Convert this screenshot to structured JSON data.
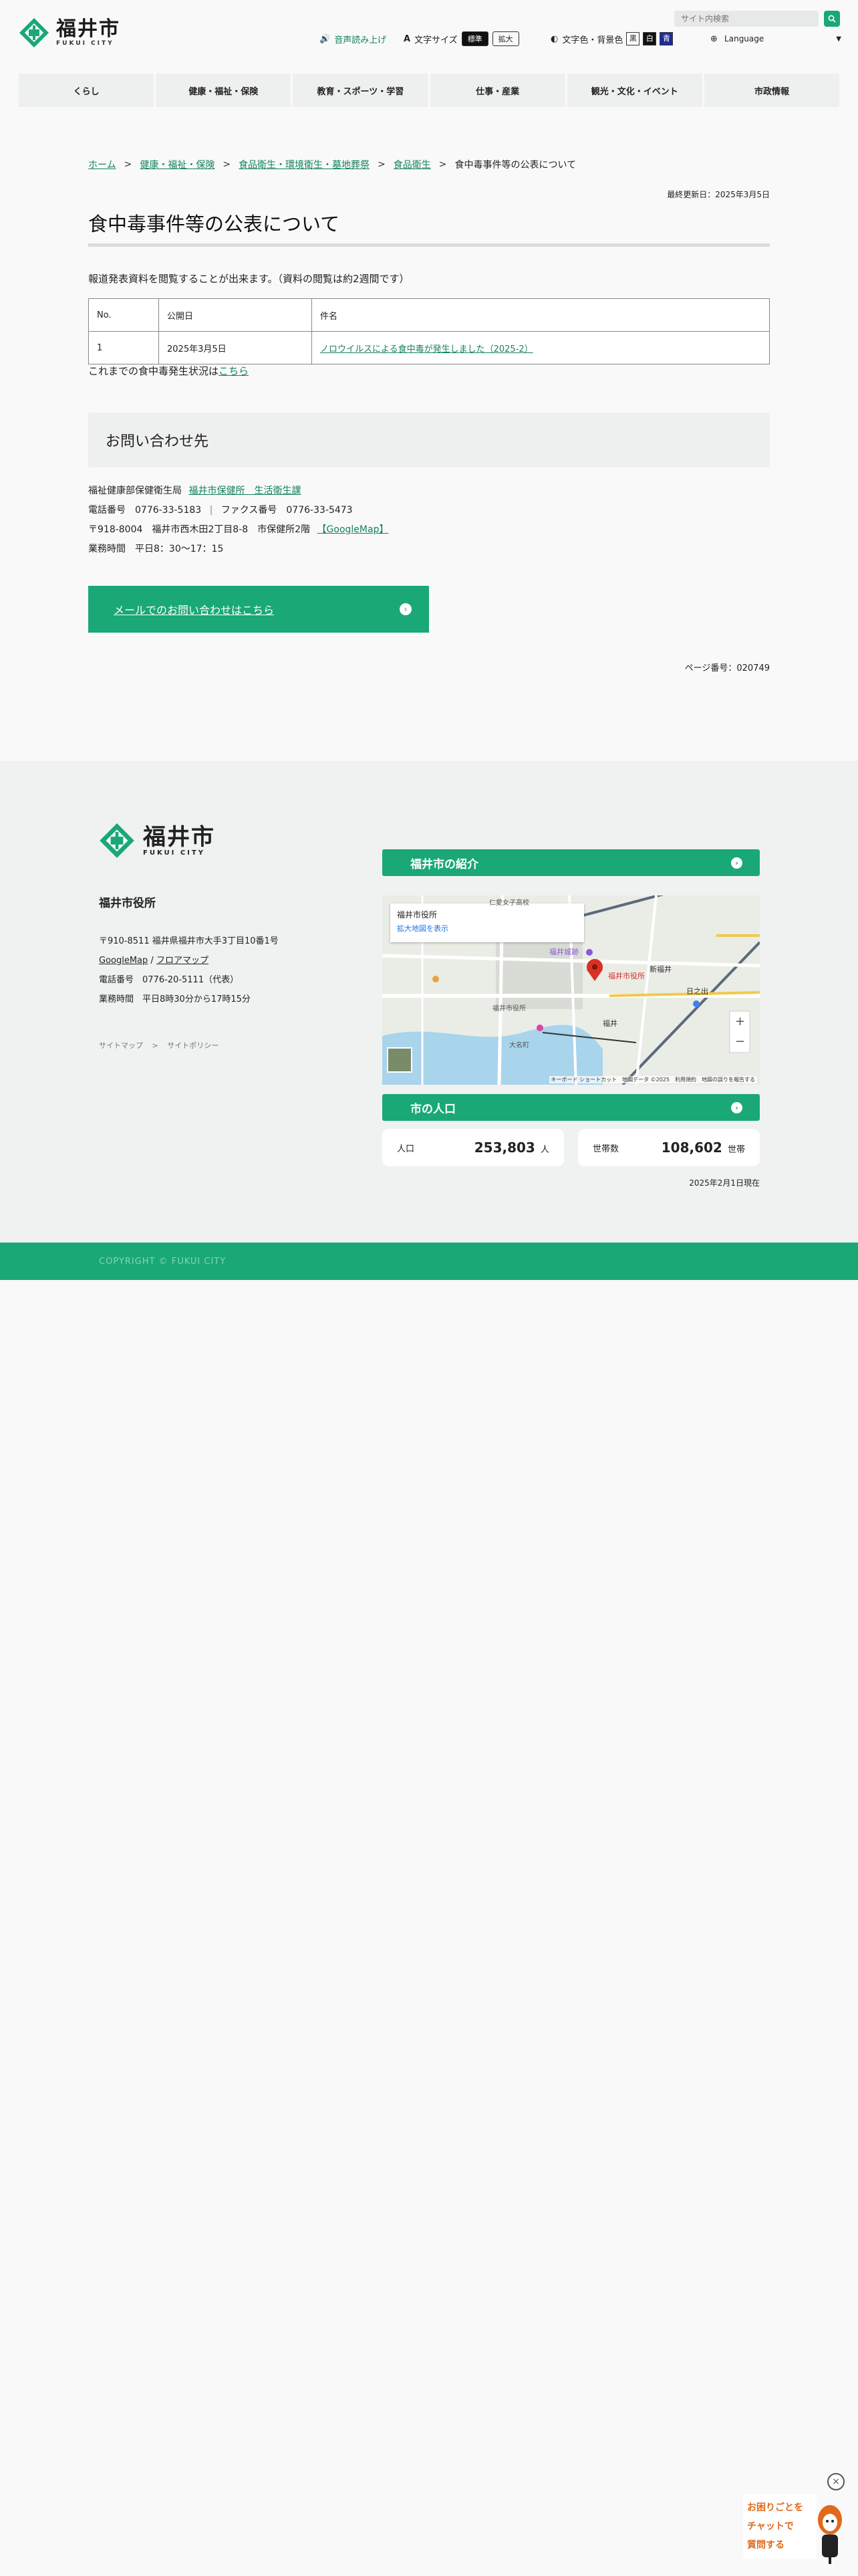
{
  "header": {
    "logo_jp": "福井市",
    "logo_en": "FUKUI CITY",
    "search_placeholder": "サイト内検索",
    "read_aloud": "音声読み上げ",
    "font_size_label": "文字サイズ",
    "font_size_options": [
      "標準",
      "拡大"
    ],
    "color_label": "文字色・背景色",
    "color_options": [
      "黒",
      "白",
      "青"
    ],
    "language_label": "Language"
  },
  "nav": [
    "くらし",
    "健康・福祉・保険",
    "教育・スポーツ・学習",
    "仕事・産業",
    "観光・文化・イベント",
    "市政情報"
  ],
  "breadcrumb": [
    "ホーム",
    "健康・福祉・保険",
    "食品衛生・環境衛生・墓地葬祭",
    "食品衛生",
    "食中毒事件等の公表について"
  ],
  "last_updated": "最終更新日：2025年3月5日",
  "page_title": "食中毒事件等の公表について",
  "intro": "報道発表資料を閲覧することが出来ます。（資料の閲覧は約2週間です）",
  "table": {
    "headers": [
      "No.",
      "公開日",
      "件名"
    ],
    "rows": [
      [
        "1",
        "2025年3月5日",
        "ノロウイルスによる食中毒が発生しました（2025-2）"
      ]
    ]
  },
  "past_text": "これまでの食中毒発生状況は",
  "past_link": "こちら",
  "contact": {
    "heading": "お問い合わせ先",
    "dept": "福祉健康部保健衛生局",
    "dept_link": "福井市保健所　生活衛生課",
    "tel": "電話番号　0776-33-5183",
    "fax": "ファクス番号　0776-33-5473",
    "address": "〒918-8004　福井市西木田2丁目8-8　市保健所2階",
    "map_link": "【GoogleMap】",
    "hours": "業務時間　平日8：30～17：15",
    "mail_button": "メールでのお問い合わせはこちら"
  },
  "page_number": "ページ番号：020749",
  "footer": {
    "city_hall": "福井市役所",
    "address": "〒910-8511 福井県福井市大手3丁目10番1号",
    "google_map": "GoogleMap",
    "floor_map": "フロアマップ",
    "tel": "電話番号　0776-20-5111（代表）",
    "hours": "業務時間　平日8時30分から17時15分",
    "links": [
      "サイトマップ",
      "サイトポリシー"
    ],
    "intro_heading": "福井市の紹介",
    "map_card_title": "福井市役所",
    "map_card_link": "拡大地図を表示",
    "map_labels": [
      "仁愛女子高校",
      "福井城跡",
      "福井市役所",
      "新福井",
      "日之出",
      "福井市役所",
      "福井",
      "大名町"
    ],
    "map_attribution": "キーボード ショートカット　地図データ ©2025　利用規約　地図の誤りを報告する",
    "population_heading": "市の人口",
    "population_label": "人口",
    "population_value": "253,803",
    "population_unit": "人",
    "households_label": "世帯数",
    "households_value": "108,602",
    "households_unit": "世帯",
    "population_date": "2025年2月1日現在",
    "copyright": "COPYRIGHT © FUKUI CITY"
  },
  "chat_widget": {
    "text": [
      "お困りごとを",
      "チャットで",
      "質問する"
    ]
  },
  "colors": {
    "brand": "#1aa876",
    "link": "#17835d",
    "chat": "#e06a1a"
  }
}
